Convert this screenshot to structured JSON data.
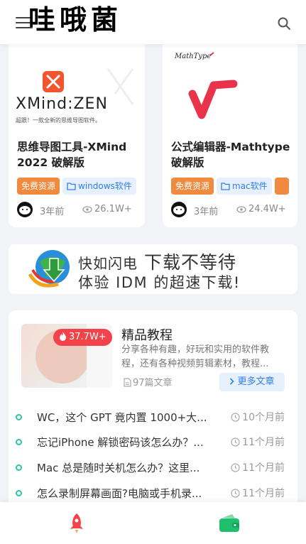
{
  "header": {
    "logo_text": "哇哦菌"
  },
  "cards": [
    {
      "thumb_brand": "XMind:ZEN",
      "thumb_caption": "超跟！一款全新的思维导图软件。",
      "title": "思维导图工具-XMind 2022 破解版",
      "tag1": "免费资源",
      "tag2": "windows软件",
      "time": "3年前",
      "views": "26.1W+"
    },
    {
      "thumb_brand": "MathType",
      "title": "公式编辑器-Mathtype 破解版",
      "tag1": "免费资源",
      "tag2": "mac软件",
      "time": "3年前",
      "views": "24.4W+"
    }
  ],
  "banner": {
    "line1_a": "快如闪电",
    "line1_b": " 下载不等待",
    "line2": "体验 IDM 的超速下载!"
  },
  "section": {
    "hot": "37.7W+",
    "title": "精品教程",
    "desc": "分享各种有趣，好玩和实用的软件教程，还有各种视频剪辑素材，教程...",
    "count": "97篇文章",
    "more": "更多文章"
  },
  "articles": [
    {
      "title": "WC，这个 GPT 竟内置 1000+大...",
      "time": "10个月前"
    },
    {
      "title": "忘记iPhone 解锁密码该怎么办？...",
      "time": "11个月前"
    },
    {
      "title": "Mac 总是随时关机怎么办？这里...",
      "time": "11个月前"
    },
    {
      "title": "怎么录制屏幕画面?电脑或手机录...",
      "time": "11个月前"
    }
  ],
  "colors": {
    "accent_blue": "#2f7ee8",
    "tag_orange": "#f08a3e",
    "hot_red": "#f2434b",
    "dot_green": "#2ec4a9"
  }
}
